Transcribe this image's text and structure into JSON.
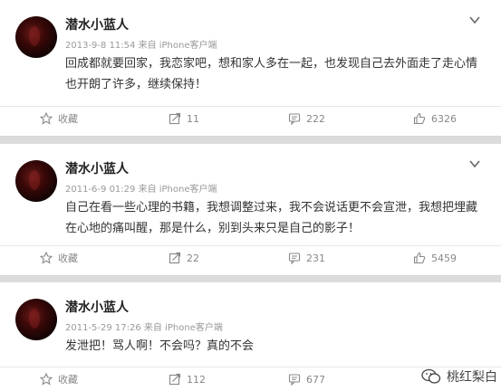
{
  "posts": [
    {
      "username": "潜水小蓝人",
      "meta": "2013-9-8 11:54 来自 iPhone客户端",
      "text": "回成都就要回家，我恋家吧，想和家人多在一起，也发现自己去外面走了走心情也开朗了许多，继续保持！",
      "favorite_label": "收藏",
      "reposts": "11",
      "comments": "222",
      "likes": "6326"
    },
    {
      "username": "潜水小蓝人",
      "meta": "2011-6-9 01:29 来自 iPhone客户端",
      "text": "自己在看一些心理的书籍，我想调整过来，我不会说话更不会宣泄，我想把埋藏在心地的痛叫醒，那是什么，别到头来只是自己的影子！",
      "favorite_label": "收藏",
      "reposts": "22",
      "comments": "231",
      "likes": "5459"
    },
    {
      "username": "潜水小蓝人",
      "meta": "2011-5-29 17:26 来自 iPhone客户端",
      "text": "发泄把！骂人啊！不会吗？真的不会",
      "favorite_label": "收藏",
      "reposts": "112",
      "comments": "677"
    }
  ],
  "watermark": "桃红梨白"
}
